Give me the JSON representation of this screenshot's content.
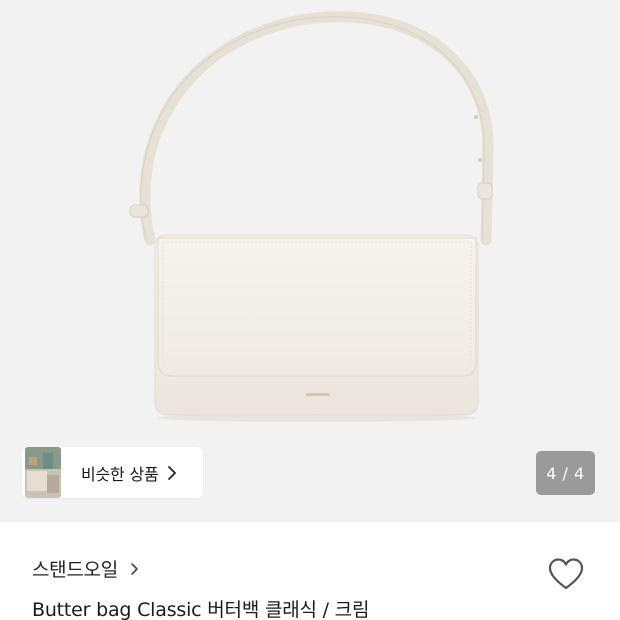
{
  "gallery": {
    "product_image_icon": "white-shoulder-bag",
    "similar_products_label": "비슷한 상품",
    "page_counter": "4 / 4",
    "current_page": 4,
    "total_pages": 4
  },
  "product": {
    "brand": "스탠드오일",
    "title": "Butter bag Classic 버터백 클래식 / 크림",
    "wishlist_icon": "heart-outline-icon"
  },
  "colors": {
    "gallery_bg": "#f2f2f2",
    "bag_cream": "#f1ede6",
    "counter_bg": "#9a9a9a"
  }
}
